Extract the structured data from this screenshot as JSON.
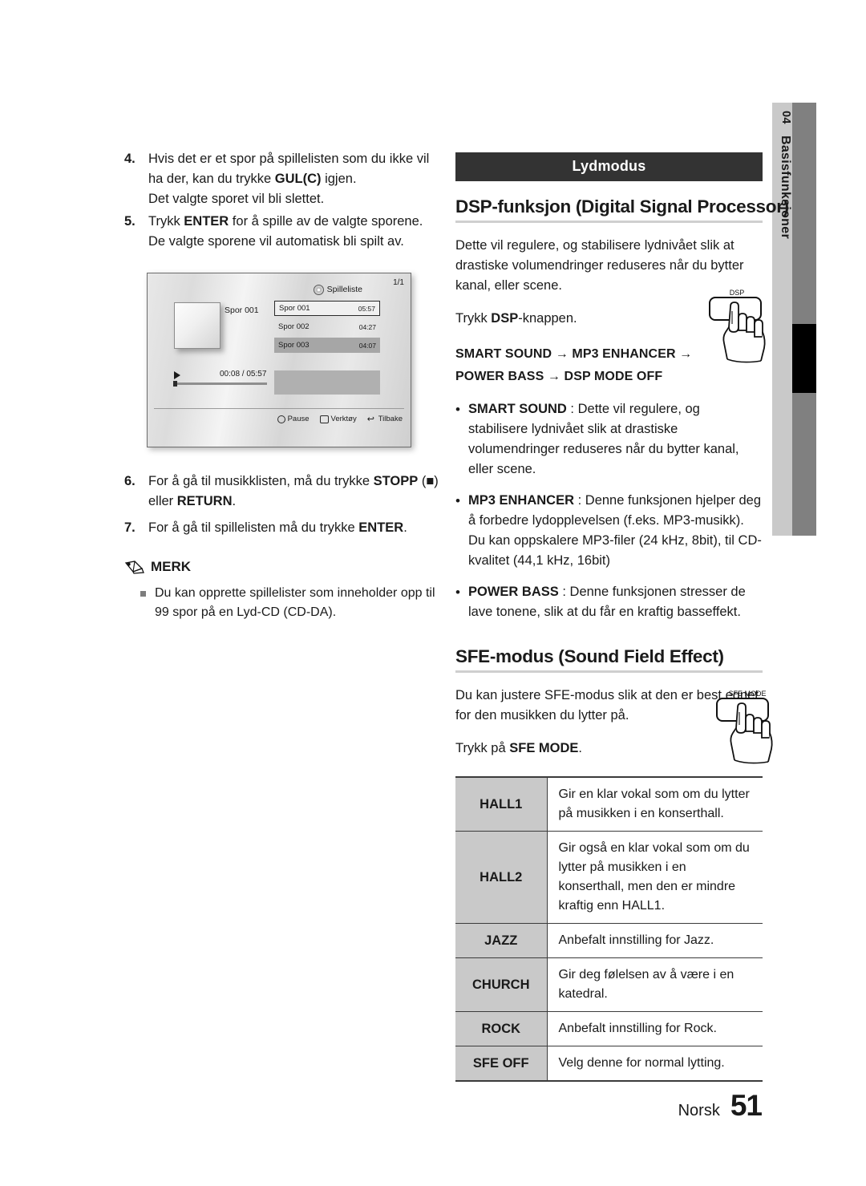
{
  "side_tab": {
    "chapter_number": "04",
    "chapter_label": "Basisfunksjoner"
  },
  "left_column": {
    "steps": [
      {
        "number": "4.",
        "line1_a": "Hvis det er et spor på spillelisten som du ikke",
        "line1_b": "vil ha der, kan du trykke ",
        "bold1": "GUL(C)",
        "line1_c": " igjen.",
        "line2": "Det valgte sporet vil bli slettet."
      },
      {
        "number": "5.",
        "pre": "Trykk ",
        "bold1": "ENTER",
        "post": " for å spille av de valgte sporene.",
        "line2": "De valgte sporene vil automatisk bli spilt av."
      },
      {
        "number": "6.",
        "pre": "For å gå til musikklisten, må du trykke ",
        "bold1": "STOPP",
        "mid": " (■) eller ",
        "bold2": "RETURN",
        "post": "."
      },
      {
        "number": "7.",
        "pre": "For å gå til spillelisten må du trykke ",
        "bold1": "ENTER",
        "post": "."
      }
    ],
    "screenshot": {
      "title": "Spilleliste",
      "page_indicator": "1/1",
      "now_playing_label": "Spor 001",
      "tracks": [
        {
          "name": "Spor 001",
          "time": "05:57",
          "state": "selected"
        },
        {
          "name": "Spor 002",
          "time": "04:27",
          "state": "plain"
        },
        {
          "name": "Spor 003",
          "time": "04:07",
          "state": "highlight"
        }
      ],
      "elapsed_total": "00:08 / 05:57",
      "buttons": [
        {
          "icon": "enter-icon",
          "label": "Pause"
        },
        {
          "icon": "tools-icon",
          "label": "Verktøy"
        },
        {
          "icon": "return-icon",
          "label": "Tilbake"
        }
      ]
    },
    "note": {
      "heading": "MERK",
      "items": [
        "Du kan opprette spillelister som inneholder opp til 99 spor på en Lyd-CD (CD-DA)."
      ]
    }
  },
  "right_column": {
    "section_bar": "Lydmodus",
    "dsp": {
      "title": "DSP-funksjon (Digital Signal Processor)",
      "intro": "Dette vil regulere, og stabilisere lydnivået slik at drastiske volumendringer reduseres når du bytter kanal, eller scene.",
      "press_pre": "Trykk ",
      "press_bold": "DSP",
      "press_post": "-knappen.",
      "button_label": "DSP",
      "sequence_line1": "SMART SOUND  → MP3 ENHANCER →",
      "sequence_line2": "POWER BASS  →  DSP MODE OFF",
      "bullets": [
        {
          "term": "SMART SOUND",
          "sep": " : ",
          "desc": "Dette vil regulere, og stabilisere lydnivået slik at drastiske volumendringer reduseres når du bytter kanal, eller scene."
        },
        {
          "term": "MP3 ENHANCER ",
          "sep": ": ",
          "desc": "Denne funksjonen hjelper deg å forbedre lydopplevelsen (f.eks. MP3-musikk). Du kan oppskalere MP3-filer (24 kHz, 8bit), til CD-kvalitet (44,1 kHz, 16bit)"
        },
        {
          "term": "POWER BASS",
          "sep": " : ",
          "desc": "Denne funksjonen stresser de lave tonene, slik at du får en kraftig basseffekt."
        }
      ]
    },
    "sfe": {
      "title": "SFE-modus (Sound Field Effect)",
      "intro": "Du kan justere SFE-modus slik at den er best egnet for den musikken du lytter på.",
      "press_pre": "Trykk på ",
      "press_bold": "SFE MODE",
      "press_post": ".",
      "button_label": "SFE MODE",
      "table": [
        {
          "name": "HALL1",
          "desc": "Gir en klar vokal som om du lytter på musikken i en konserthall."
        },
        {
          "name": "HALL2",
          "desc": "Gir også en klar vokal som om du lytter på musikken i en konserthall, men den er mindre kraftig enn HALL1."
        },
        {
          "name": "JAZZ",
          "desc": "Anbefalt innstilling for Jazz."
        },
        {
          "name": "CHURCH",
          "desc": "Gir deg følelsen av å være i en katedral."
        },
        {
          "name": "ROCK",
          "desc": "Anbefalt innstilling for Rock."
        },
        {
          "name": "SFE OFF",
          "desc": "Velg denne for normal lytting."
        }
      ]
    }
  },
  "footer": {
    "language": "Norsk",
    "page": "51"
  }
}
